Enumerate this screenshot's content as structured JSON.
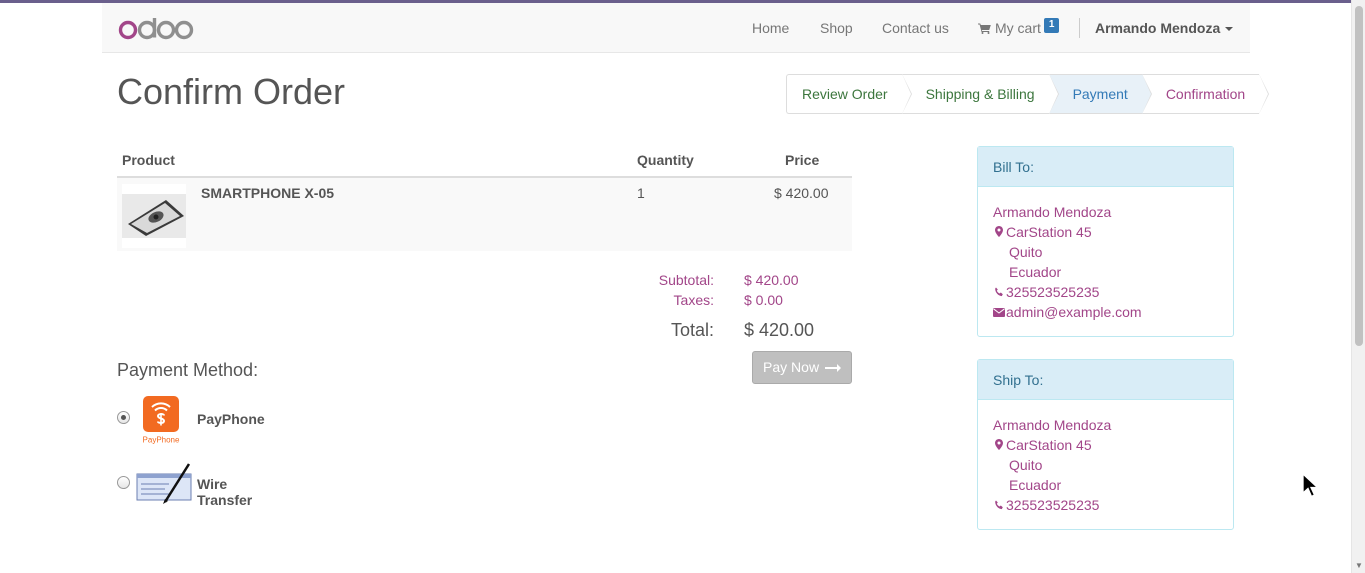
{
  "navbar": {
    "logo": "odoo",
    "items": [
      {
        "label": "Home"
      },
      {
        "label": "Shop"
      },
      {
        "label": "Contact us"
      }
    ],
    "cart_label": "My cart",
    "cart_count": "1",
    "user_name": "Armando Mendoza"
  },
  "page": {
    "title": "Confirm Order"
  },
  "wizard": {
    "steps": [
      {
        "label": "Review Order",
        "state": "done"
      },
      {
        "label": "Shipping & Billing",
        "state": "done"
      },
      {
        "label": "Payment",
        "state": "active"
      },
      {
        "label": "Confirmation",
        "state": "todo"
      }
    ]
  },
  "cart": {
    "headers": {
      "product": "Product",
      "quantity": "Quantity",
      "price": "Price"
    },
    "rows": [
      {
        "name": "SMARTPHONE X-05",
        "quantity": "1",
        "price": "$ 420.00"
      }
    ]
  },
  "totals": {
    "subtotal_label": "Subtotal:",
    "subtotal": "$ 420.00",
    "taxes_label": "Taxes:",
    "taxes": "$ 0.00",
    "total_label": "Total:",
    "total": "$ 420.00"
  },
  "pay_button": "Pay Now",
  "payment": {
    "title": "Payment Method:",
    "methods": [
      {
        "name": "PayPhone",
        "logo_caption": "PayPhone",
        "selected": true
      },
      {
        "name": "Wire Transfer",
        "selected": false
      }
    ]
  },
  "bill_to": {
    "heading": "Bill To:",
    "name": "Armando Mendoza",
    "street": "CarStation 45",
    "city": "Quito",
    "country": "Ecuador",
    "phone": "325523525235",
    "email": "admin@example.com"
  },
  "ship_to": {
    "heading": "Ship To:",
    "name": "Armando Mendoza",
    "street": "CarStation 45",
    "city": "Quito",
    "country": "Ecuador",
    "phone": "325523525235"
  },
  "colors": {
    "brand": "#a24689",
    "link": "#a24689",
    "panel_head": "#d9edf7",
    "active_step": "#337ab7",
    "done_step": "#3c763d"
  }
}
